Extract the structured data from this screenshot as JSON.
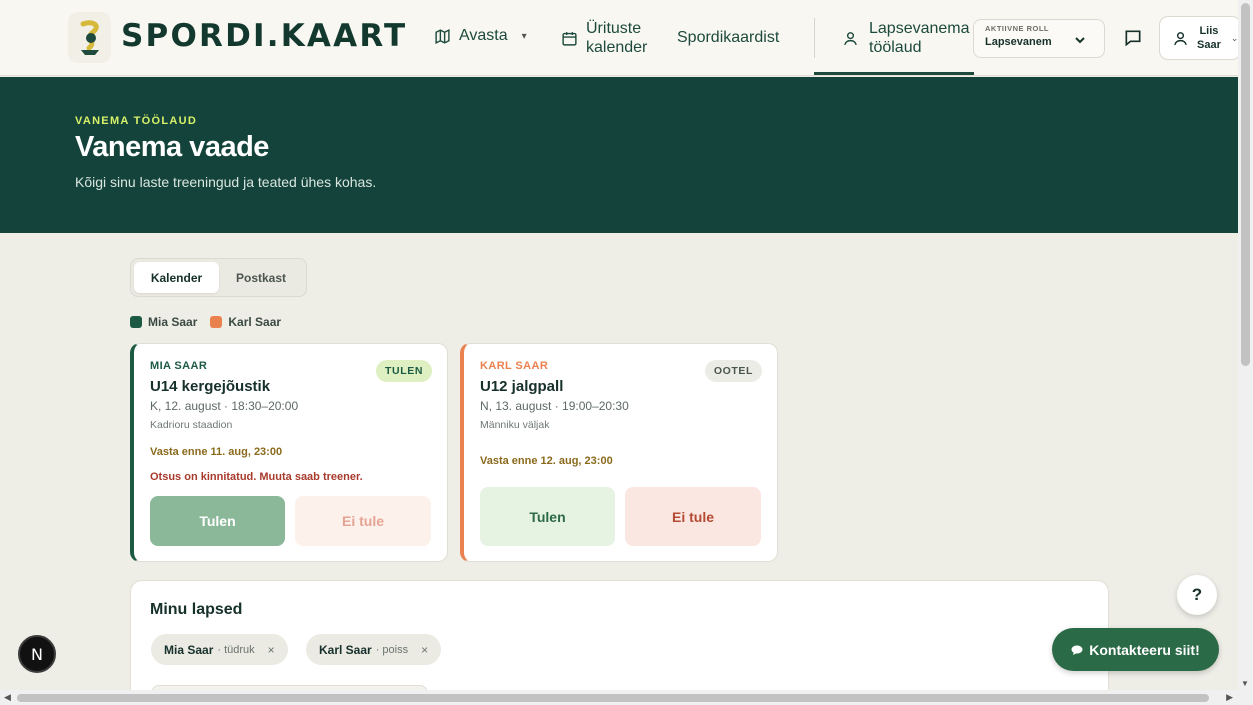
{
  "header": {
    "brand": "SPORDI.KAART",
    "nav": {
      "avasta": "Avasta",
      "urituste_line1": "Ürituste",
      "urituste_line2": "kalender",
      "spordikaardist": "Spordikaardist",
      "lapsevanema_line1": "Lapsevanema",
      "lapsevanema_line2": "töölaud"
    },
    "role": {
      "label": "AKTIIVNE ROLL",
      "value": "Lapsevanem"
    },
    "user": {
      "first": "Liis",
      "last": "Saar"
    }
  },
  "hero": {
    "eyebrow": "VANEMA TÖÖLAUD",
    "title": "Vanema vaade",
    "subtitle": "Kõigi sinu laste treeningud ja teated ühes kohas."
  },
  "tabs": [
    "Kalender",
    "Postkast"
  ],
  "legend": [
    {
      "name": "Mia Saar",
      "color": "#1d5a44"
    },
    {
      "name": "Karl Saar",
      "color": "#e9824f"
    }
  ],
  "events": [
    {
      "child": "MIA SAAR",
      "child_color": "#1d5a44",
      "status": "TULEN",
      "title": "U14 kergejõustik",
      "time": "K, 12. august · 18:30–20:00",
      "place": "Kadrioru staadion",
      "deadline": "Vasta enne 11. aug, 23:00",
      "note": "Otsus on kinnitatud. Muuta saab treener.",
      "yes_label": "Tulen",
      "no_label": "Ei tule"
    },
    {
      "child": "KARL SAAR",
      "child_color": "#e9824f",
      "status": "OOTEL",
      "title": "U12 jalgpall",
      "time": "N, 13. august · 19:00–20:30",
      "place": "Männiku väljak",
      "deadline": "Vasta enne 12. aug, 23:00",
      "yes_label": "Tulen",
      "no_label": "Ei tule"
    }
  ],
  "kids": {
    "title": "Minu lapsed",
    "items": [
      {
        "name": "Mia Saar",
        "meta": "· tüdruk",
        "remove": "×"
      },
      {
        "name": "Karl Saar",
        "meta": "· poiss",
        "remove": "×"
      }
    ]
  },
  "floating": {
    "help": "?",
    "contact": "Kontakteeru siit!",
    "n_badge": "N"
  }
}
